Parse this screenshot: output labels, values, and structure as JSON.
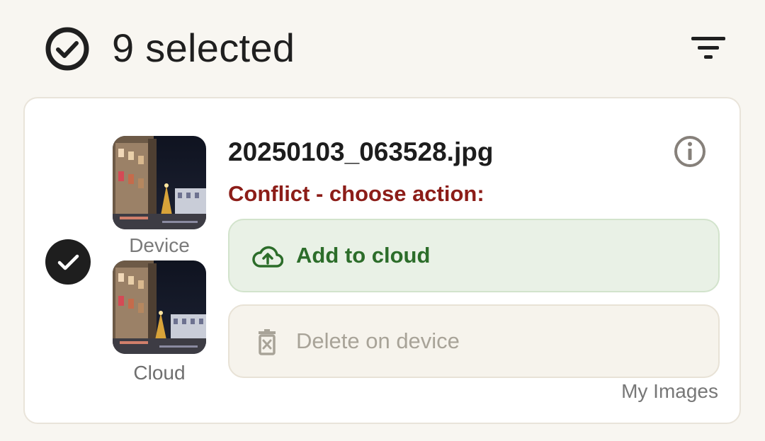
{
  "header": {
    "selection_count_text": "9 selected",
    "selected_icon": "check-circle-outline-icon",
    "filter_icon": "filter-list-icon"
  },
  "item": {
    "filename": "20250103_063528.jpg",
    "info_icon": "info-circle-icon",
    "status_text": "Conflict - choose action:",
    "selected": true,
    "checkbox_icon": "check-circle-filled-icon",
    "device_label": "Device",
    "cloud_label": "Cloud",
    "actions": {
      "primary": {
        "label": "Add to cloud",
        "icon": "cloud-upload-icon"
      },
      "secondary": {
        "label": "Delete on device",
        "icon": "delete-icon",
        "disabled": true
      }
    },
    "folder": "My Images"
  },
  "colors": {
    "background": "#f8f6f1",
    "card": "#ffffff",
    "conflict_red": "#8c1d18",
    "primary_green": "#2c6d2a",
    "primary_bg": "#e9f1e6",
    "disabled_text": "#a8a398"
  }
}
